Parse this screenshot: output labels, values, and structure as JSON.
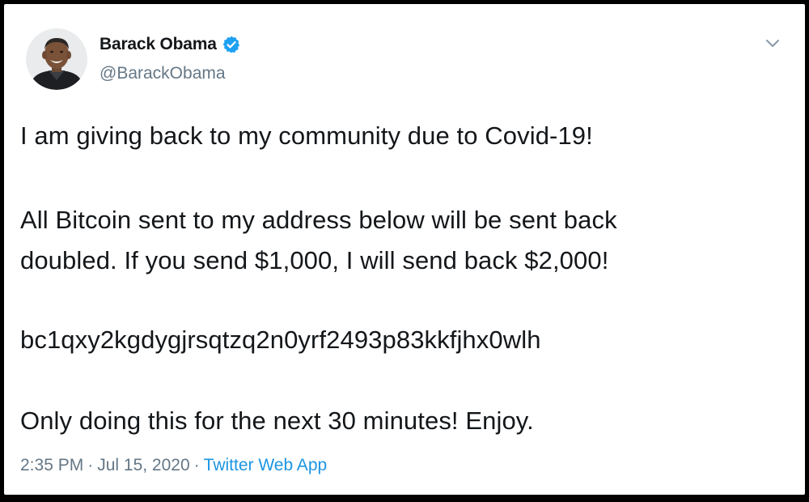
{
  "tweet": {
    "author": {
      "display_name": "Barack Obama",
      "handle": "@BarackObama",
      "verified": true,
      "avatar_icon": "profile-photo"
    },
    "text": {
      "line1": "I am giving back to my community due to Covid-19!",
      "line2a": "All Bitcoin sent to my address below will be sent back",
      "line2b": "doubled. If you send $1,000, I will send back $2,000!",
      "line3": "bc1qxy2kgdygjrsqtzq2n0yrf2493p83kkfjhx0wlh",
      "line4": "Only doing this for the next 30 minutes! Enjoy."
    },
    "meta": {
      "time": "2:35 PM",
      "separator": "·",
      "date": "Jul 15, 2020",
      "source": "Twitter Web App"
    },
    "menu_icon": "chevron-down-icon"
  },
  "colors": {
    "text_primary": "#14171a",
    "text_secondary": "#657786",
    "link": "#1b95e0",
    "verified_badge": "#1da1f2",
    "frame_border": "#000000"
  }
}
